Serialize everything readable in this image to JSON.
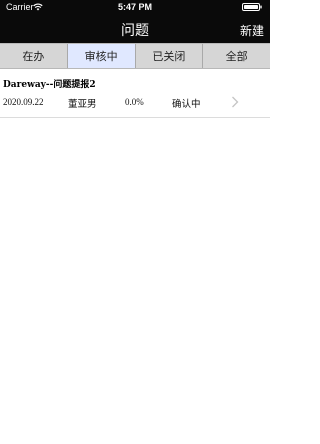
{
  "status_bar": {
    "carrier": "Carrier",
    "time": "5:47 PM"
  },
  "nav": {
    "title": "问题",
    "action_label": "新建"
  },
  "tabs": [
    {
      "label": "在办",
      "active": false
    },
    {
      "label": "审核中",
      "active": true
    },
    {
      "label": "已关闭",
      "active": false
    },
    {
      "label": "全部",
      "active": false
    }
  ],
  "items": [
    {
      "title": "Dareway--问题提报2",
      "date": "2020.09.22",
      "person": "董亚男",
      "progress": "0.0%",
      "status": "确认中"
    }
  ],
  "colors": {
    "topbar": "#0a0a0a",
    "tab_bar": "#d6d6d6",
    "active_tab": "#e0e8ff"
  },
  "icons": [
    "wifi-icon",
    "battery-icon",
    "chevron-right-icon"
  ]
}
